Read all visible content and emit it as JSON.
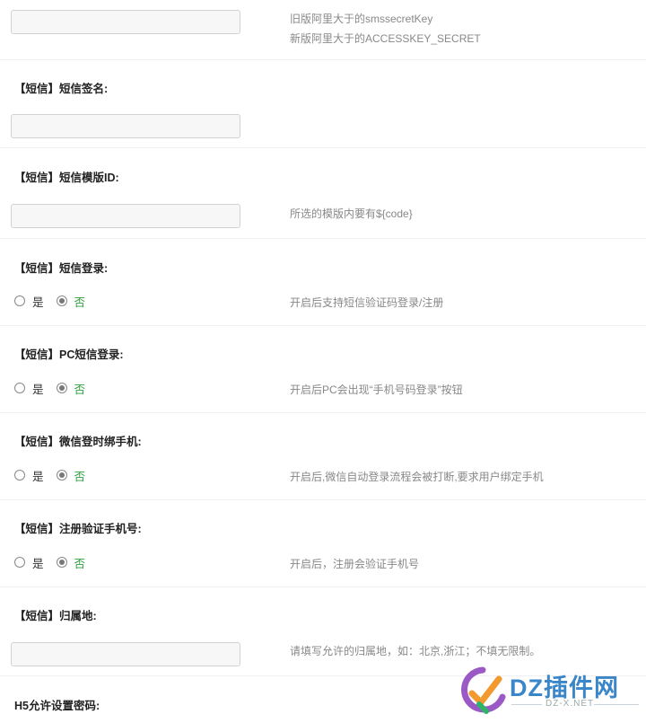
{
  "rows": [
    {
      "id": "secret",
      "input_value": "",
      "hints": [
        "旧版阿里大于的smssecretKey",
        "新版阿里大于的ACCESSKEY_SECRET"
      ]
    },
    {
      "id": "sign",
      "label": "【短信】短信签名:",
      "input_value": ""
    },
    {
      "id": "template",
      "label": "【短信】短信模版ID:",
      "input_value": "",
      "hint": "所选的模版内要有${code}"
    },
    {
      "id": "sms_login",
      "label": "【短信】短信登录:",
      "options": [
        "是",
        "否"
      ],
      "selected": "否",
      "hint": "开启后支持短信验证码登录/注册"
    },
    {
      "id": "pc_login",
      "label": "【短信】PC短信登录:",
      "options": [
        "是",
        "否"
      ],
      "selected": "否",
      "hint": "开启后PC会出现“手机号码登录”按钮"
    },
    {
      "id": "wechat_bind",
      "label": "【短信】微信登时绑手机:",
      "options": [
        "是",
        "否"
      ],
      "selected": "否",
      "hint": "开启后,微信自动登录流程会被打断,要求用户绑定手机"
    },
    {
      "id": "register_verify",
      "label": "【短信】注册验证手机号:",
      "options": [
        "是",
        "否"
      ],
      "selected": "否",
      "hint": "开启后，注册会验证手机号"
    },
    {
      "id": "region",
      "label": "【短信】归属地:",
      "input_value": "",
      "hint": "请填写允许的归属地，如：北京,浙江；不填无限制。"
    },
    {
      "id": "h5_password",
      "label": "H5允许设置密码:"
    }
  ],
  "watermark": {
    "text": "DZ插件网",
    "sub": "DZ-X.NET",
    "colors": {
      "blue": "#3a86c8",
      "orange": "#f29a2e",
      "purple": "#9b59c6",
      "green": "#2fb36b"
    }
  },
  "colors": {
    "selected_text": "#2e9e3e",
    "hint": "#888888",
    "separator": "#eef0f2"
  }
}
